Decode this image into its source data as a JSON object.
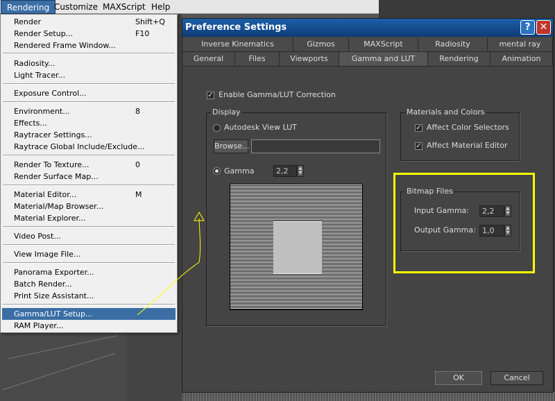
{
  "menubar": {
    "items": [
      "Rendering",
      "Customize",
      "MAXScript",
      "Help"
    ]
  },
  "menu": {
    "items": [
      {
        "label": "Render",
        "shortcut": "Shift+Q"
      },
      {
        "label": "Render Setup...",
        "shortcut": "F10"
      },
      {
        "label": "Rendered Frame Window...",
        "shortcut": ""
      },
      {
        "label": "Radiosity...",
        "shortcut": ""
      },
      {
        "label": "Light Tracer...",
        "shortcut": ""
      },
      {
        "label": "Exposure Control...",
        "shortcut": ""
      },
      {
        "label": "Environment...",
        "shortcut": "8"
      },
      {
        "label": "Effects...",
        "shortcut": ""
      },
      {
        "label": "Raytracer Settings...",
        "shortcut": ""
      },
      {
        "label": "Raytrace Global Include/Exclude...",
        "shortcut": ""
      },
      {
        "label": "Render To Texture...",
        "shortcut": "0"
      },
      {
        "label": "Render Surface Map...",
        "shortcut": ""
      },
      {
        "label": "Material Editor...",
        "shortcut": "M"
      },
      {
        "label": "Material/Map Browser...",
        "shortcut": ""
      },
      {
        "label": "Material Explorer...",
        "shortcut": ""
      },
      {
        "label": "Video Post...",
        "shortcut": ""
      },
      {
        "label": "View Image File...",
        "shortcut": ""
      },
      {
        "label": "Panorama Exporter...",
        "shortcut": ""
      },
      {
        "label": "Batch Render...",
        "shortcut": ""
      },
      {
        "label": "Print Size Assistant...",
        "shortcut": ""
      },
      {
        "label": "Gamma/LUT Setup...",
        "shortcut": ""
      },
      {
        "label": "RAM Player...",
        "shortcut": ""
      }
    ]
  },
  "dialog": {
    "title": "Preference Settings",
    "help_icon": "?",
    "close_icon": "✕",
    "tabs_row1": [
      "Inverse Kinematics",
      "Gizmos",
      "MAXScript",
      "Radiosity",
      "mental ray"
    ],
    "tabs_row2": [
      "General",
      "Files",
      "Viewports",
      "Gamma and LUT",
      "Rendering",
      "Animation"
    ],
    "enable_label": "Enable Gamma/LUT Correction",
    "display": {
      "group_label": "Display",
      "autodesk_label": "Autodesk View LUT",
      "browse_label": "Browse...",
      "gamma_label": "Gamma",
      "gamma_value": "2,2"
    },
    "materials": {
      "group_label": "Materials and Colors",
      "affect_color": "Affect Color Selectors",
      "affect_material": "Affect Material Editor"
    },
    "bitmap": {
      "group_label": "Bitmap Files",
      "input_label": "Input Gamma:",
      "input_value": "2,2",
      "output_label": "Output Gamma:",
      "output_value": "1,0"
    },
    "ok_label": "OK",
    "cancel_label": "Cancel"
  },
  "colors": {
    "highlight": "#ffff00",
    "selection": "#3a6ea5",
    "title_bar": "#1d5fa8"
  }
}
